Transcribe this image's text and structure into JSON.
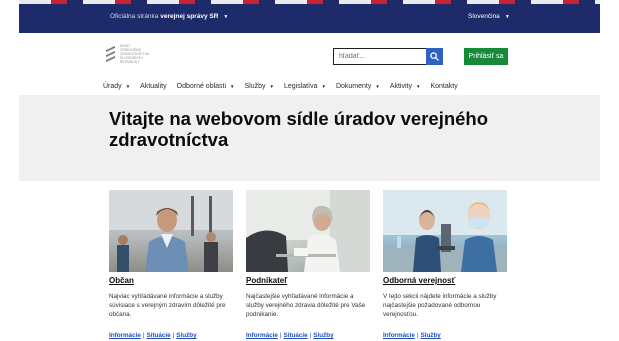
{
  "govbar": {
    "official_prefix": "Oficiálna stránka ",
    "official_bold": "verejnej správy SR",
    "language": "Slovenčina"
  },
  "header": {
    "logo_lines": [
      "ÚRAD",
      "VEREJNÉHO",
      "ZDRAVOTNÍCTVA",
      "SLOVENSKEJ",
      "REPUBLIKY"
    ],
    "search_placeholder": "hľadať...",
    "login_label": "Prihlásiť sa"
  },
  "nav": {
    "items": [
      {
        "label": "Úrady",
        "dropdown": true
      },
      {
        "label": "Aktuality",
        "dropdown": false
      },
      {
        "label": "Odborné oblasti",
        "dropdown": true
      },
      {
        "label": "Služby",
        "dropdown": true
      },
      {
        "label": "Legislatíva",
        "dropdown": true
      },
      {
        "label": "Dokumenty",
        "dropdown": true
      },
      {
        "label": "Aktivity",
        "dropdown": true
      },
      {
        "label": "Kontakty",
        "dropdown": false
      }
    ]
  },
  "hero": {
    "title": "Vitajte na webovom sídle úradov verejného zdravotníctva"
  },
  "cards": [
    {
      "title": "Občan",
      "description": "Najviac vyhľadávané informácie a služby súvisiace s verejným zdravím dôležité pre občana.",
      "links": [
        "Informácie",
        "Situácie",
        "Služby"
      ]
    },
    {
      "title": "Podnikateľ",
      "description": "Najčastejšie vyhľadávané informácie a služby verejného zdravia dôležité pre Vaše podnikanie.",
      "links": [
        "Informácie",
        "Situácie",
        "Služby"
      ]
    },
    {
      "title": "Odborná verejnosť",
      "description": "V tejto sekcii nájdete informácie a služby najčastejšie požadované odbornou verejnosťou.",
      "links": [
        "Informácie",
        "Služby"
      ]
    }
  ],
  "colors": {
    "govbar": "#1d2b6b",
    "search_button": "#2f61c4",
    "login_button": "#168a39",
    "hero_bg": "#f0f0f0",
    "link": "#1d4fb6"
  }
}
